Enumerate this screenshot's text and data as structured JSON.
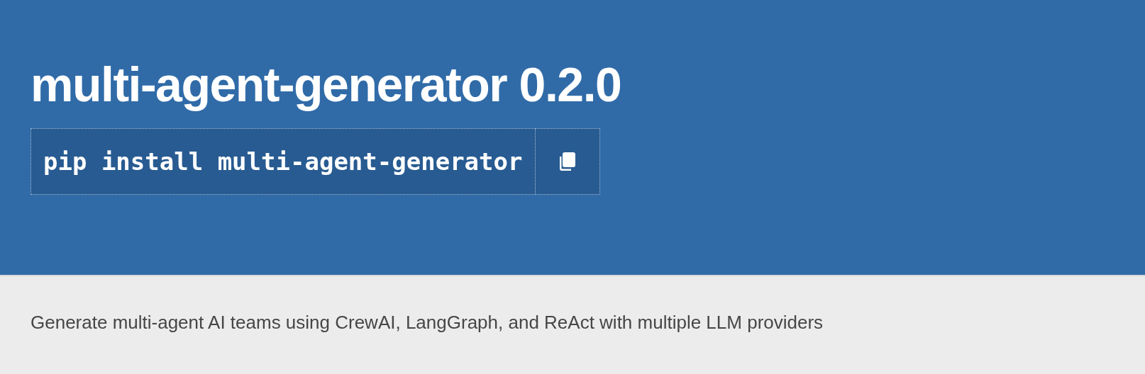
{
  "package": {
    "name": "multi-agent-generator",
    "version": "0.2.0"
  },
  "install": {
    "command": "pip install multi-agent-generator"
  },
  "description": "Generate multi-agent AI teams using CrewAI, LangGraph, and ReAct with multiple LLM providers"
}
